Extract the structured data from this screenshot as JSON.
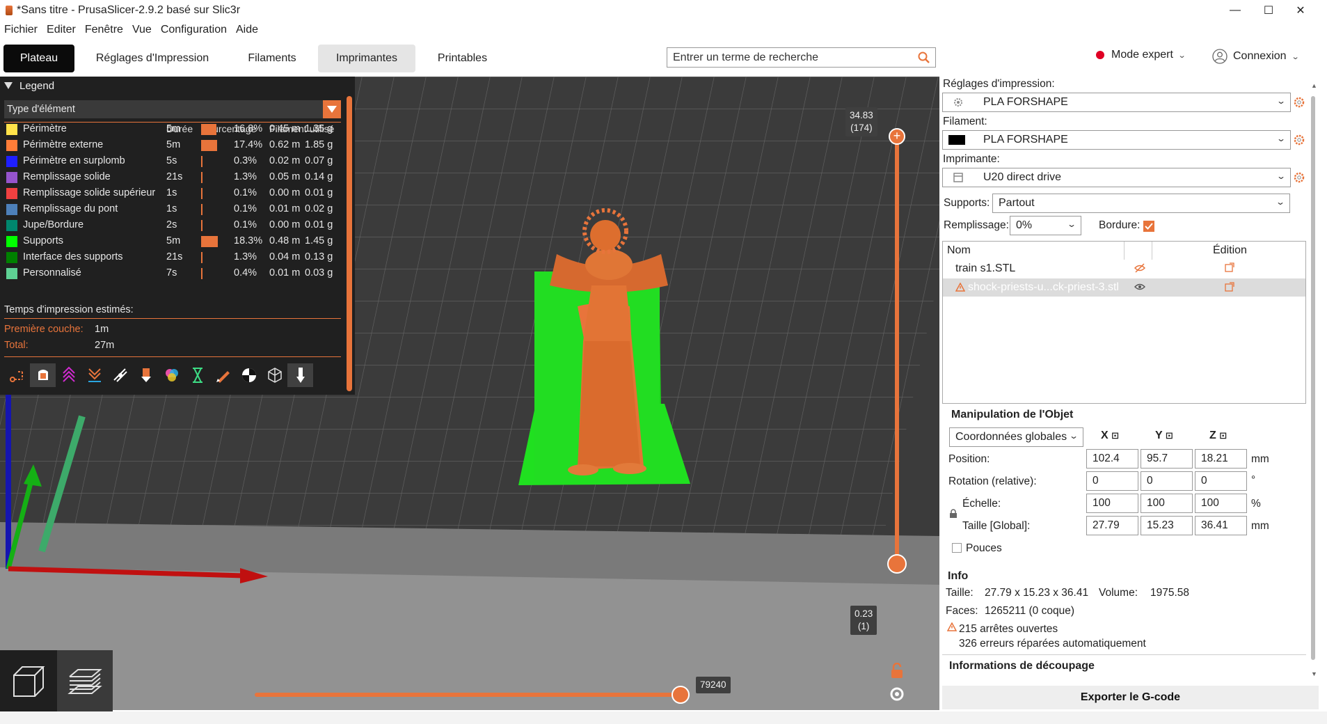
{
  "window": {
    "title": "*Sans titre - PrusaSlicer-2.9.2 basé sur Slic3r",
    "minimize": "—",
    "maximize": "☐",
    "close": "✕"
  },
  "menu": [
    "Fichier",
    "Editer",
    "Fenêtre",
    "Vue",
    "Configuration",
    "Aide"
  ],
  "tabs": [
    "Plateau",
    "Réglages d'Impression",
    "Filaments",
    "Imprimantes",
    "Printables"
  ],
  "search": {
    "placeholder": "Entrer un terme de recherche"
  },
  "mode": {
    "label": "Mode expert",
    "color": "#e00024"
  },
  "login": {
    "label": "Connexion"
  },
  "legend": {
    "title": "Legend",
    "view_type": "Type d'élément",
    "columns": [
      "Durée",
      "Pourcentage",
      "Filament utilisé"
    ],
    "rows": [
      {
        "name": "Périmètre",
        "color": "#ffe24a",
        "duration": "5m",
        "percent": 16.8,
        "percent_text": "16.8%",
        "meters": "0.45 m",
        "grams": "1.35 g"
      },
      {
        "name": "Périmètre externe",
        "color": "#ff7d38",
        "duration": "5m",
        "percent": 17.4,
        "percent_text": "17.4%",
        "meters": "0.62 m",
        "grams": "1.85 g"
      },
      {
        "name": "Périmètre en surplomb",
        "color": "#1f1fff",
        "duration": "5s",
        "percent": 0.3,
        "percent_text": "0.3%",
        "meters": "0.02 m",
        "grams": "0.07 g"
      },
      {
        "name": "Remplissage solide",
        "color": "#9654cc",
        "duration": "21s",
        "percent": 1.3,
        "percent_text": "1.3%",
        "meters": "0.05 m",
        "grams": "0.14 g"
      },
      {
        "name": "Remplissage solide supérieur",
        "color": "#f04040",
        "duration": "1s",
        "percent": 0.1,
        "percent_text": "0.1%",
        "meters": "0.00 m",
        "grams": "0.01 g"
      },
      {
        "name": "Remplissage du pont",
        "color": "#4d80ba",
        "duration": "1s",
        "percent": 0.1,
        "percent_text": "0.1%",
        "meters": "0.01 m",
        "grams": "0.02 g"
      },
      {
        "name": "Jupe/Bordure",
        "color": "#00876e",
        "duration": "2s",
        "percent": 0.1,
        "percent_text": "0.1%",
        "meters": "0.00 m",
        "grams": "0.01 g"
      },
      {
        "name": "Supports",
        "color": "#00ff00",
        "duration": "5m",
        "percent": 18.3,
        "percent_text": "18.3%",
        "meters": "0.48 m",
        "grams": "1.45 g"
      },
      {
        "name": "Interface des supports",
        "color": "#008000",
        "duration": "21s",
        "percent": 1.3,
        "percent_text": "1.3%",
        "meters": "0.04 m",
        "grams": "0.13 g"
      },
      {
        "name": "Personnalisé",
        "color": "#5ed194",
        "duration": "7s",
        "percent": 0.4,
        "percent_text": "0.4%",
        "meters": "0.01 m",
        "grams": "0.03 g"
      }
    ],
    "estimated_title": "Temps d'impression estimés:",
    "first_layer_label": "Première couche:",
    "first_layer_value": "1m",
    "total_label": "Total:",
    "total_value": "27m"
  },
  "layer_slider": {
    "top_value": "34.83",
    "top_layer": "(174)",
    "bottom_value": "0.23",
    "bottom_layer": "(1)"
  },
  "move_slider": {
    "value": "79240"
  },
  "accent_color": "#e8743b",
  "right_panel": {
    "print_settings_label": "Réglages d'impression:",
    "print_settings_value": "PLA FORSHAPE",
    "filament_label": "Filament:",
    "filament_value": "PLA FORSHAPE",
    "printer_label": "Imprimante:",
    "printer_value": "U20 direct drive",
    "supports_label": "Supports:",
    "supports_value": "Partout",
    "infill_label": "Remplissage:",
    "infill_value": "0%",
    "brim_label": "Bordure:",
    "list_name_header": "Nom",
    "list_edit_header": "Édition",
    "objects": [
      {
        "name": "train s1.STL"
      },
      {
        "name": "shock-priests-u...ck-priest-3.stl"
      }
    ],
    "manipulation_title": "Manipulation de l'Objet",
    "coord_system": "Coordonnées globales",
    "axes": [
      "X",
      "Y",
      "Z"
    ],
    "position_label": "Position:",
    "position": [
      "102.4",
      "95.7",
      "18.21"
    ],
    "position_unit": "mm",
    "rotation_label": "Rotation (relative):",
    "rotation": [
      "0",
      "0",
      "0"
    ],
    "rotation_unit": "°",
    "scale_label": "Échelle:",
    "scale": [
      "100",
      "100",
      "100"
    ],
    "scale_unit": "%",
    "size_label": "Taille [Global]:",
    "size": [
      "27.79",
      "15.23",
      "36.41"
    ],
    "size_unit": "mm",
    "inches_label": "Pouces",
    "info_title": "Info",
    "size_info_label": "Taille:",
    "size_info_value": "27.79 x 15.23 x 36.41",
    "volume_label": "Volume:",
    "volume_value": "1975.58",
    "faces_label": "Faces:",
    "faces_value": "1265211 (0 coque)",
    "open_edges": "215 arrêtes ouvertes",
    "repaired": "326 erreurs réparées automatiquement",
    "slice_info_title": "Informations de découpage",
    "export_button": "Exporter le G-code"
  }
}
